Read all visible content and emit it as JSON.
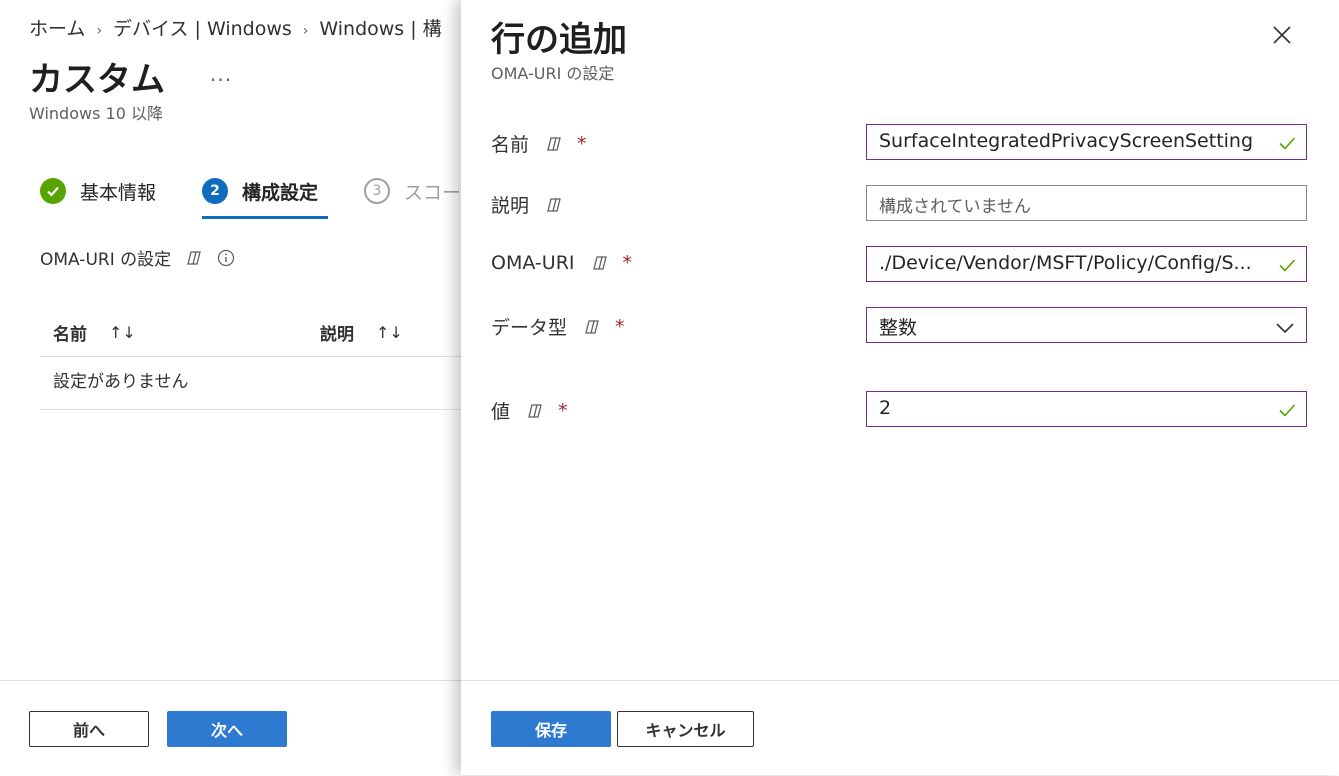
{
  "breadcrumb": {
    "items": [
      "ホーム",
      "デバイス | Windows",
      "Windows | 構"
    ]
  },
  "page": {
    "title": "カスタム",
    "more": "...",
    "subtitle": "Windows 10 以降"
  },
  "steps": [
    {
      "number": "",
      "label": "基本情報",
      "state": "done"
    },
    {
      "number": "2",
      "label": "構成設定",
      "state": "active"
    },
    {
      "number": "3",
      "label": "スコープ",
      "state": "todo"
    }
  ],
  "section": {
    "title": "OMA-URI の設定"
  },
  "table": {
    "columns": [
      "名前",
      "説明"
    ],
    "sort_glyph": "↑↓",
    "empty_text": "設定がありません"
  },
  "bg_footer": {
    "prev_label": "前へ",
    "next_label": "次へ"
  },
  "blade": {
    "title": "行の追加",
    "subtitle": "OMA-URI の設定",
    "required_marker": "*",
    "fields": {
      "name": {
        "label": "名前",
        "value": "SurfaceIntegratedPrivacyScreenSetting",
        "required": true
      },
      "description": {
        "label": "説明",
        "placeholder": "構成されていません",
        "required": false
      },
      "oma_uri": {
        "label": "OMA-URI",
        "value": "./Device/Vendor/MSFT/Policy/Config/S...",
        "required": true
      },
      "data_type": {
        "label": "データ型",
        "value": "整数",
        "required": true
      },
      "value": {
        "label": "値",
        "value": "2",
        "required": true
      }
    },
    "footer": {
      "save_label": "保存",
      "cancel_label": "キャンセル"
    }
  },
  "colors": {
    "accent": "#2f7ad1",
    "step_done": "#57a300",
    "step_active": "#0f6cbd",
    "valid_border": "#7a2c8c",
    "valid_check": "#57a300",
    "required": "#a4262c"
  }
}
